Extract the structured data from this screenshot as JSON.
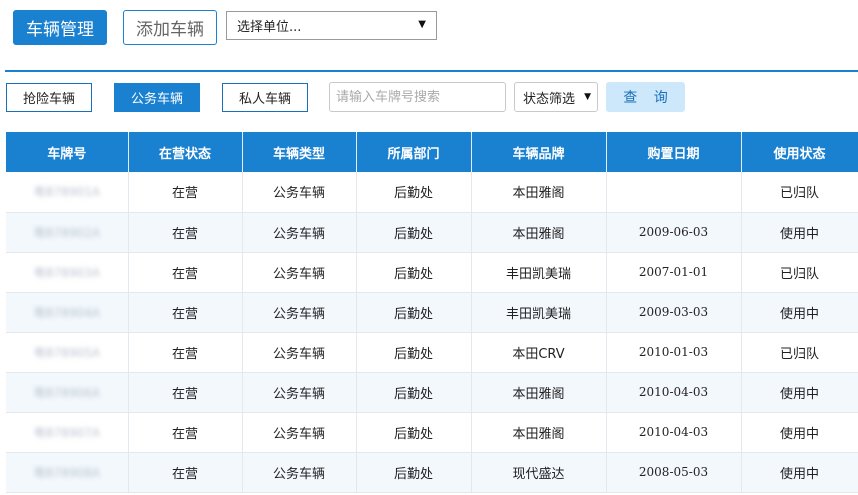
{
  "header": {
    "vehicle_mgmt_label": "车辆管理",
    "add_vehicle_label": "添加车辆",
    "unit_select_value": "选择单位..."
  },
  "filters": {
    "rescue_label": "抢险车辆",
    "official_label": "公务车辆",
    "private_label": "私人车辆",
    "search_placeholder": "请输入车牌号搜索",
    "status_filter_label": "状态筛选",
    "query_label": "查 询"
  },
  "table": {
    "columns": [
      "车牌号",
      "在营状态",
      "车辆类型",
      "所属部门",
      "车辆品牌",
      "购置日期",
      "使用状态"
    ],
    "rows": [
      {
        "plate": "粤B78901A",
        "op": "在营",
        "type": "公务车辆",
        "dept": "后勤处",
        "brand": "本田雅阁",
        "date": "",
        "use": "已归队"
      },
      {
        "plate": "粤B78902A",
        "op": "在营",
        "type": "公务车辆",
        "dept": "后勤处",
        "brand": "本田雅阁",
        "date": "2009-06-03",
        "use": "使用中"
      },
      {
        "plate": "粤B78903A",
        "op": "在营",
        "type": "公务车辆",
        "dept": "后勤处",
        "brand": "丰田凯美瑞",
        "date": "2007-01-01",
        "use": "已归队"
      },
      {
        "plate": "粤B78904A",
        "op": "在营",
        "type": "公务车辆",
        "dept": "后勤处",
        "brand": "丰田凯美瑞",
        "date": "2009-03-03",
        "use": "使用中"
      },
      {
        "plate": "粤B78905A",
        "op": "在营",
        "type": "公务车辆",
        "dept": "后勤处",
        "brand": "本田CRV",
        "date": "2010-01-03",
        "use": "已归队"
      },
      {
        "plate": "粤B78906A",
        "op": "在营",
        "type": "公务车辆",
        "dept": "后勤处",
        "brand": "本田雅阁",
        "date": "2010-04-03",
        "use": "使用中"
      },
      {
        "plate": "粤B78907A",
        "op": "在营",
        "type": "公务车辆",
        "dept": "后勤处",
        "brand": "本田雅阁",
        "date": "2010-04-03",
        "use": "使用中"
      },
      {
        "plate": "粤B78908A",
        "op": "在营",
        "type": "公务车辆",
        "dept": "后勤处",
        "brand": "现代盛达",
        "date": "2008-05-03",
        "use": "使用中"
      }
    ]
  },
  "colors": {
    "accent": "#1a80d0",
    "query_bg": "#cde8fb",
    "row_alt": "#f3f8fd"
  },
  "icons": {
    "select_arrow": "caret-down-icon"
  }
}
